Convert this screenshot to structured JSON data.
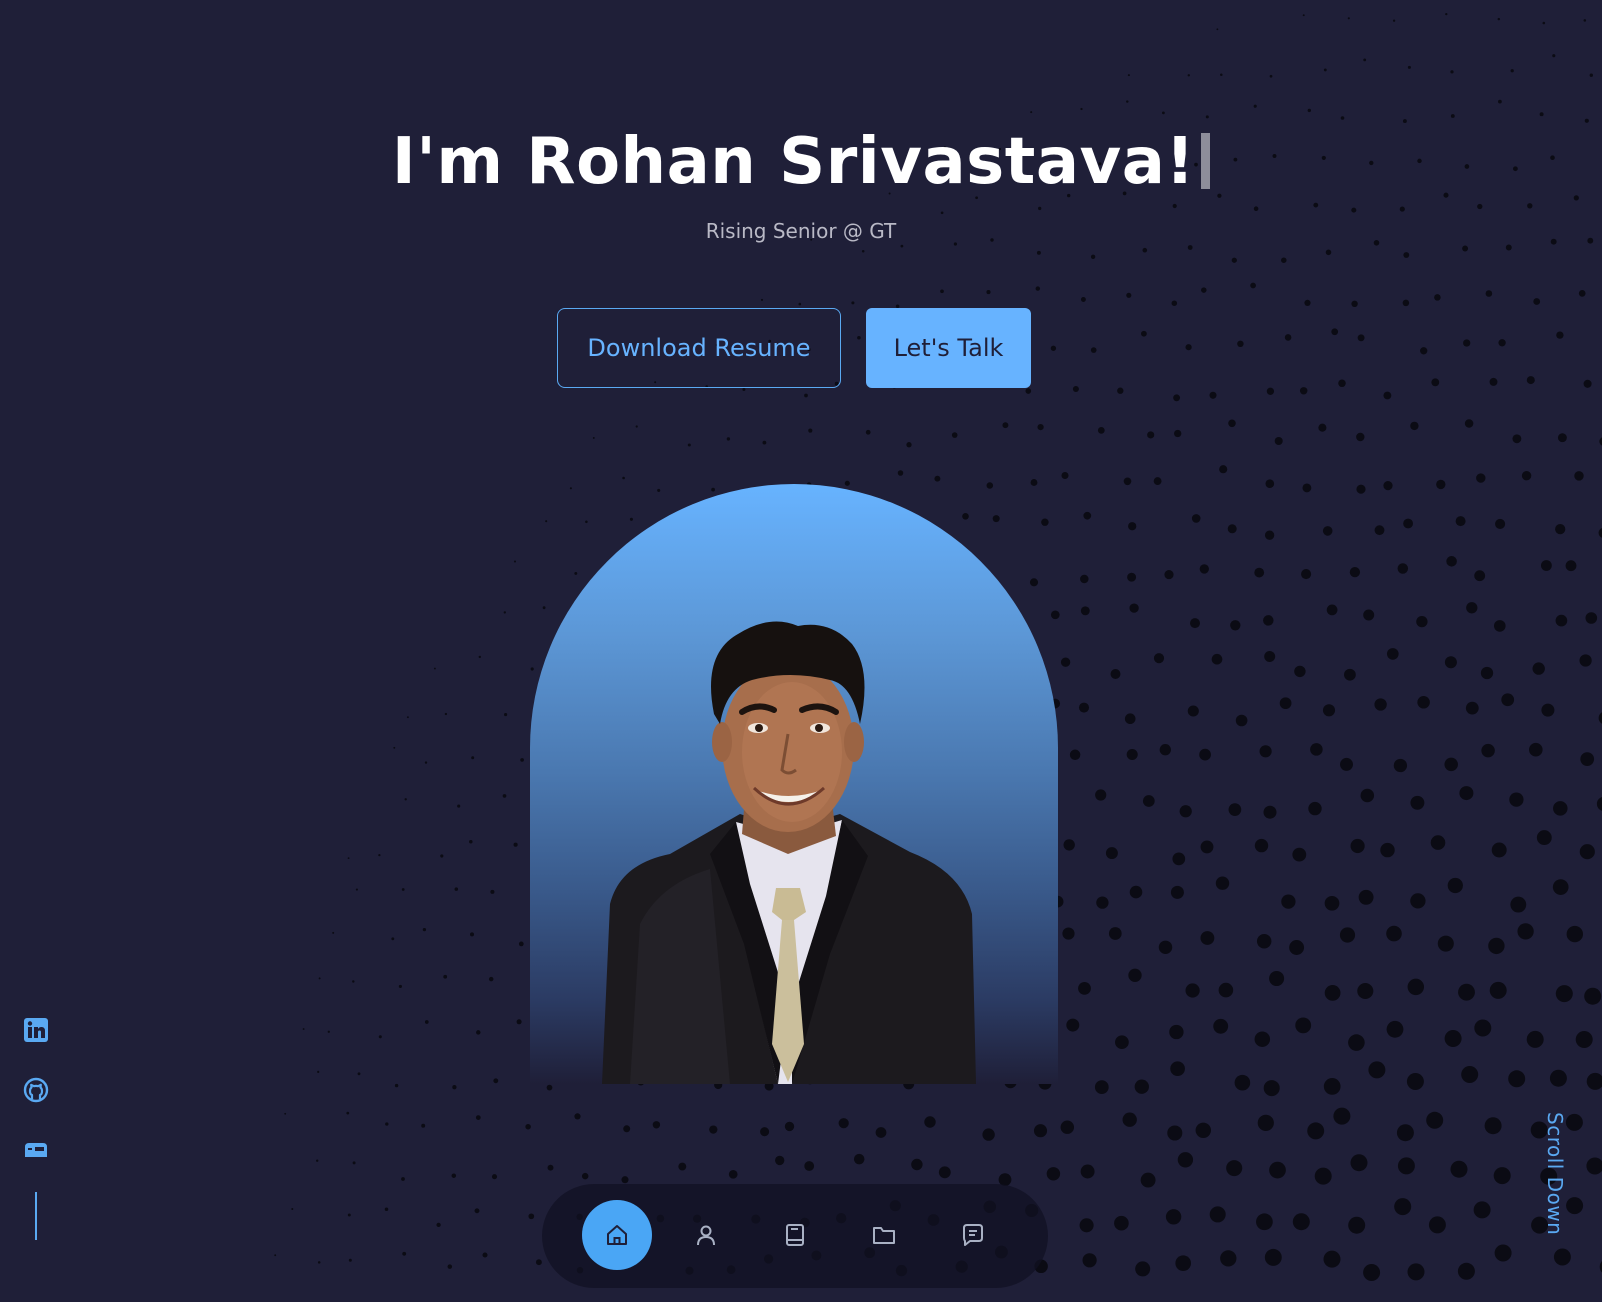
{
  "hero": {
    "title": "I'm Rohan Srivastava!",
    "subtitle": "Rising Senior @ GT"
  },
  "buttons": {
    "download_label": "Download Resume",
    "talk_label": "Let's Talk"
  },
  "portrait": {
    "subject": "portrait-photo"
  },
  "socials": [
    {
      "icon": "linkedin-icon"
    },
    {
      "icon": "github-icon"
    },
    {
      "icon": "mailbox-icon"
    }
  ],
  "scroll_label": "Scroll Down",
  "nav": {
    "items": [
      {
        "icon": "home-icon",
        "active": true
      },
      {
        "icon": "user-icon",
        "active": false
      },
      {
        "icon": "book-icon",
        "active": false
      },
      {
        "icon": "folder-icon",
        "active": false
      },
      {
        "icon": "message-icon",
        "active": false
      }
    ]
  },
  "colors": {
    "background": "#1f1f38",
    "accent": "#67b3ff",
    "text": "#ffffff",
    "muted_text": "#b9b9c6"
  }
}
